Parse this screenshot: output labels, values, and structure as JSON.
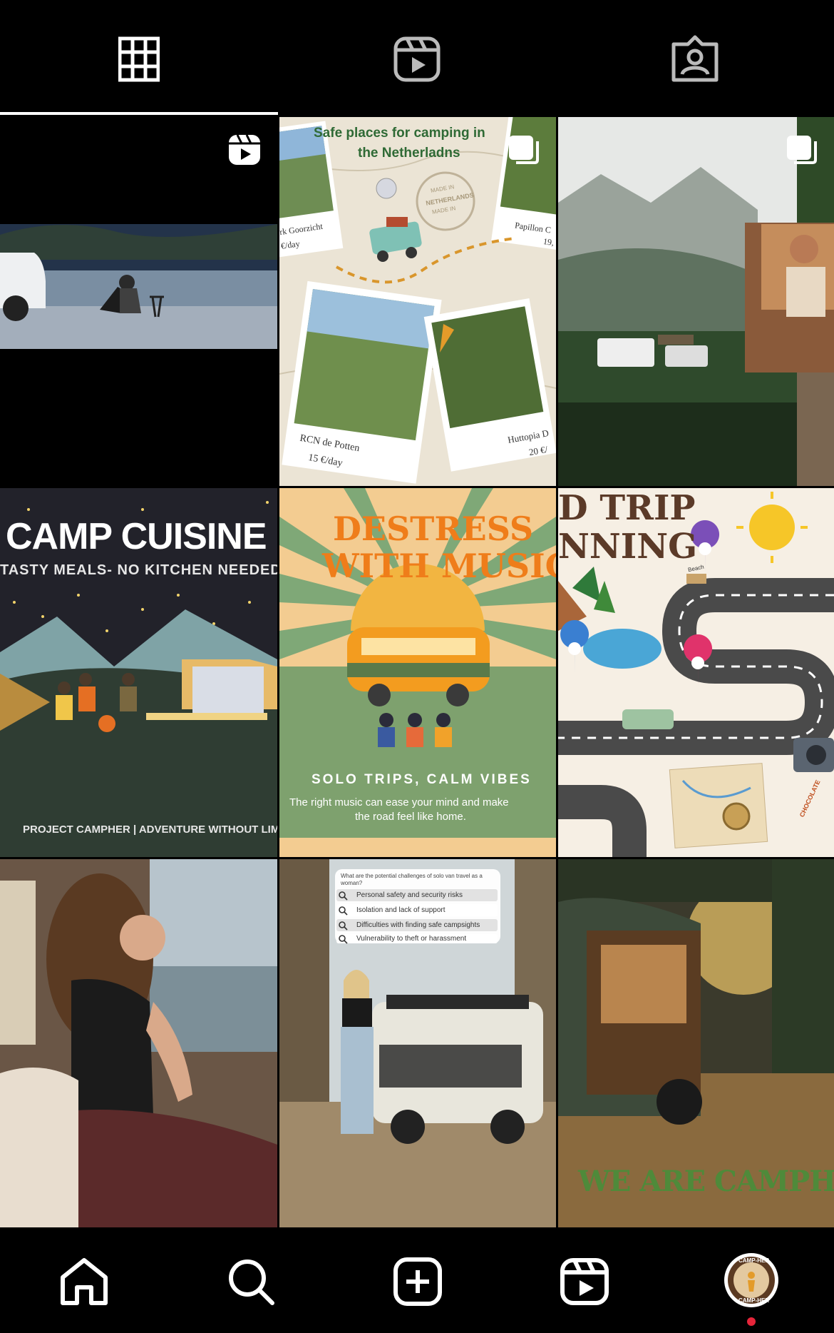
{
  "tabs": [
    {
      "icon": "grid-icon",
      "active": true
    },
    {
      "icon": "reels-icon",
      "active": false
    },
    {
      "icon": "tagged-icon",
      "active": false
    }
  ],
  "posts": {
    "p1": {
      "badge": "reels-icon"
    },
    "p2": {
      "badge": "carousel-icon",
      "title_line1": "Safe places for camping  in",
      "title_line2": "the Netherladns",
      "stamp_line1": "MADE IN",
      "stamp_line2": "NETHERLANDS",
      "stamp_line3": "MADE IN",
      "photo1_caption_line1": "rk Goorzicht",
      "photo1_caption_line2": "€/day",
      "photo2_caption_line1": "Papillon C",
      "photo2_caption_line2": "19,",
      "photo3_caption_line1": "RCN de Potten",
      "photo3_caption_line2": "15 €/day",
      "photo4_caption_line1": "Huttopia D",
      "photo4_caption_line2": "20 €/"
    },
    "p3": {
      "badge": "carousel-icon"
    },
    "p4": {
      "title": "CAMP CUISINE",
      "subtitle": "TASTY MEALS- NO KITCHEN NEEDED",
      "footer": "PROJECT CAMPHER | ADVENTURE WITHOUT LIMITS"
    },
    "p5": {
      "title_line1": "DESTRESS",
      "title_line2": "WITH MUSIC",
      "subtitle": "SOLO TRIPS, CALM VIBES",
      "body_line1": "The right music can ease your mind and make",
      "body_line2": "the road feel like home."
    },
    "p6": {
      "title_line1": "D TRIP",
      "title_line2": "NNING",
      "sign": "Beach",
      "tag": "CHOCOLATE"
    },
    "p7": {},
    "p8": {
      "question_line1": "What are the potential challenges of solo van travel as a",
      "question_line2": "woman?",
      "options": [
        "Personal safety and security risks",
        "Isolation and lack of support",
        "Difficulties with finding safe campsights",
        "Vulnerability to theft or harassment"
      ]
    },
    "p9": {
      "caption": "WE ARE CAMPHER"
    }
  },
  "bottom_nav": [
    {
      "icon": "home-icon"
    },
    {
      "icon": "search-icon"
    },
    {
      "icon": "create-icon"
    },
    {
      "icon": "reels-icon"
    },
    {
      "icon": "profile-avatar",
      "avatar_text_top": "CAMP-HER",
      "avatar_text_bottom": "CAMP-HER",
      "notification": true
    }
  ],
  "colors": {
    "background": "#000000",
    "foreground": "#ffffff",
    "notification_dot": "#e6253a"
  }
}
